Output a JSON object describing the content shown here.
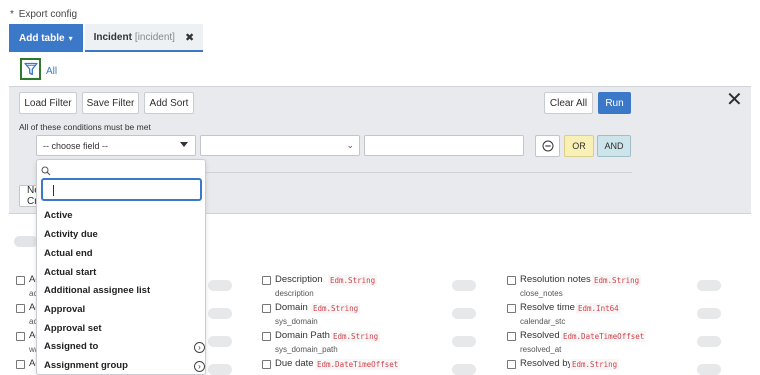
{
  "header": {
    "required_mark": "*",
    "label": "Export config"
  },
  "tabs": {
    "add_table_label": "Add table",
    "caret": "▾",
    "incident_label": "Incident",
    "incident_table": "[incident]",
    "close": "✖"
  },
  "filter_summary": {
    "all_label": "All"
  },
  "toolbar": {
    "load_filter": "Load Filter",
    "save_filter": "Save Filter",
    "add_sort": "Add Sort",
    "clear_all": "Clear All",
    "run": "Run",
    "close": "✕"
  },
  "condition": {
    "label": "All of these conditions must be met",
    "field_placeholder": "-- choose field --",
    "or_label": "OR",
    "and_label": "AND",
    "new_label": "New Criteria"
  },
  "dropdown": {
    "items": [
      {
        "label": "Active",
        "has_submenu": false
      },
      {
        "label": "Activity due",
        "has_submenu": false
      },
      {
        "label": "Actual end",
        "has_submenu": false
      },
      {
        "label": "Actual start",
        "has_submenu": false
      },
      {
        "label": "Additional assignee list",
        "has_submenu": false
      },
      {
        "label": "Approval",
        "has_submenu": false
      },
      {
        "label": "Approval set",
        "has_submenu": false
      },
      {
        "label": "Assigned to",
        "has_submenu": true
      },
      {
        "label": "Assignment group",
        "has_submenu": true
      }
    ]
  },
  "fields": {
    "col1": [
      {
        "name": "Ac",
        "sub": "ac"
      },
      {
        "name": "Ac",
        "sub": "ac"
      },
      {
        "name": "Ac",
        "sub": "wa"
      },
      {
        "name": "Ac",
        "sub": ""
      }
    ],
    "col2": [
      {
        "name": "Description",
        "type": "Edm.String",
        "sub": "description"
      },
      {
        "name": "Domain",
        "type": "Edm.String",
        "sub": "sys_domain"
      },
      {
        "name": "Domain Path",
        "type": "Edm.String",
        "sub": "sys_domain_path"
      },
      {
        "name": "Due date",
        "type": "Edm.DateTimeOffset",
        "sub": ""
      }
    ],
    "col3": [
      {
        "name": "Resolution notes",
        "type": "Edm.String",
        "sub": "close_notes"
      },
      {
        "name": "Resolve time",
        "type": "Edm.Int64",
        "sub": "calendar_stc"
      },
      {
        "name": "Resolved",
        "type": "Edm.DateTimeOffset",
        "sub": "resolved_at"
      },
      {
        "name": "Resolved by",
        "type": "Edm.String",
        "sub": ""
      }
    ]
  },
  "icons": {
    "filter": "funnel-icon",
    "search": "search-icon",
    "remove": "minus-circle-icon",
    "submenu": "chevron-right-circle-icon"
  },
  "colors": {
    "accent": "#3b78c7",
    "filter_border": "#2d7a2d",
    "or_bg": "#f9f0b6",
    "and_bg": "#cce4ea",
    "type_text": "#d33f49"
  }
}
